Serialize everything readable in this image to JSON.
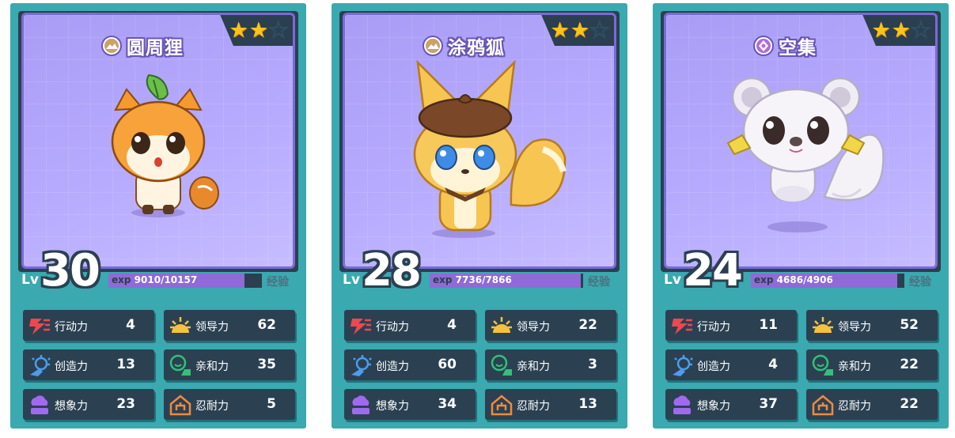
{
  "cards": [
    {
      "name": "圆周狸",
      "rarity_icon": "mountain-icon",
      "stars": [
        true,
        true,
        false
      ],
      "lv_label": "Lv",
      "level": "30",
      "exp_label": "exp",
      "exp_current": "9010",
      "exp_sep_max": "/10157",
      "exp_progress": 0.887,
      "exp_button": "经验",
      "pet": "fox-leaf",
      "stats": [
        {
          "label": "行动力",
          "value": "4",
          "icon": "action-icon"
        },
        {
          "label": "领导力",
          "value": "62",
          "icon": "leadership-icon"
        },
        {
          "label": "创造力",
          "value": "13",
          "icon": "creativity-icon"
        },
        {
          "label": "亲和力",
          "value": "35",
          "icon": "affinity-icon"
        },
        {
          "label": "想象力",
          "value": "23",
          "icon": "imagination-icon"
        },
        {
          "label": "忍耐力",
          "value": "5",
          "icon": "endurance-icon"
        }
      ]
    },
    {
      "name": "涂鸦狐",
      "rarity_icon": "mountain-icon",
      "stars": [
        true,
        true,
        false
      ],
      "lv_label": "Lv",
      "level": "28",
      "exp_label": "exp",
      "exp_current": "7736",
      "exp_sep_max": "/7866",
      "exp_progress": 0.983,
      "exp_button": "经验",
      "pet": "fox-beret",
      "stats": [
        {
          "label": "行动力",
          "value": "4",
          "icon": "action-icon"
        },
        {
          "label": "领导力",
          "value": "22",
          "icon": "leadership-icon"
        },
        {
          "label": "创造力",
          "value": "60",
          "icon": "creativity-icon"
        },
        {
          "label": "亲和力",
          "value": "3",
          "icon": "affinity-icon"
        },
        {
          "label": "想象力",
          "value": "34",
          "icon": "imagination-icon"
        },
        {
          "label": "忍耐力",
          "value": "13",
          "icon": "endurance-icon"
        }
      ]
    },
    {
      "name": "空集",
      "rarity_icon": "purple-gem-icon",
      "stars": [
        true,
        true,
        false
      ],
      "lv_label": "Lv",
      "level": "24",
      "exp_label": "exp",
      "exp_current": "4686",
      "exp_sep_max": "/4906",
      "exp_progress": 0.955,
      "exp_button": "经验",
      "pet": "white-koala",
      "stats": [
        {
          "label": "行动力",
          "value": "11",
          "icon": "action-icon"
        },
        {
          "label": "领导力",
          "value": "52",
          "icon": "leadership-icon"
        },
        {
          "label": "创造力",
          "value": "4",
          "icon": "creativity-icon"
        },
        {
          "label": "亲和力",
          "value": "22",
          "icon": "affinity-icon"
        },
        {
          "label": "想象力",
          "value": "37",
          "icon": "imagination-icon"
        },
        {
          "label": "忍耐力",
          "value": "22",
          "icon": "endurance-icon"
        }
      ]
    }
  ]
}
